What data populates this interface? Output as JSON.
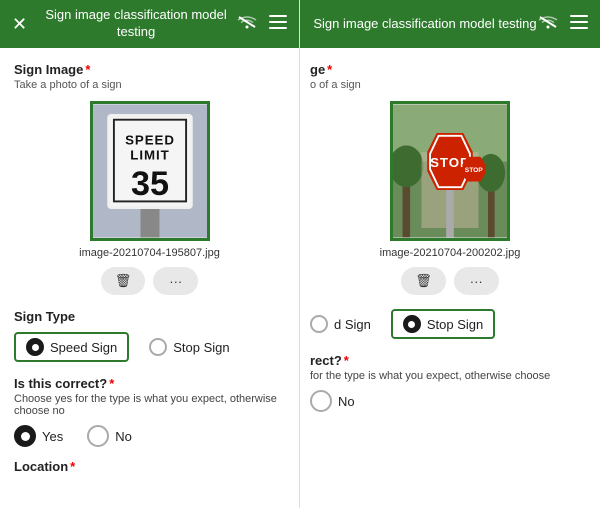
{
  "app": {
    "title": "Sign image classification model testing"
  },
  "left_panel": {
    "header": {
      "title": "Sign image classification model\ntesting",
      "close_label": "✕",
      "wifi_icon": "wifi-off",
      "menu_icon": "menu"
    },
    "sign_image_label": "Sign Image",
    "sign_image_subtitle": "Take a photo of a sign",
    "image_filename": "image-20210704-195807.jpg",
    "delete_icon": "🗑",
    "more_icon": "···",
    "sign_type_label": "Sign Type",
    "option_speed": "Speed Sign",
    "option_stop": "Stop Sign",
    "is_correct_label": "Is this correct?",
    "is_correct_desc": "Choose yes for the type is what you expect, otherwise choose no",
    "yes_label": "Yes",
    "no_label": "No",
    "location_label": "Location"
  },
  "right_panel": {
    "header": {
      "title": "Sign image classification model testing",
      "wifi_icon": "wifi-off",
      "menu_icon": "menu"
    },
    "sign_image_label": "ge",
    "sign_image_subtitle": "o of a sign",
    "image_filename": "image-20210704-200202.jpg",
    "delete_icon": "🗑",
    "more_icon": "···",
    "option_speed_partial": "d Sign",
    "option_stop": "Stop Sign",
    "is_correct_partial": "rect?",
    "is_correct_desc_partial": "for the type is what you expect, otherwise choose",
    "no_label": "No"
  }
}
